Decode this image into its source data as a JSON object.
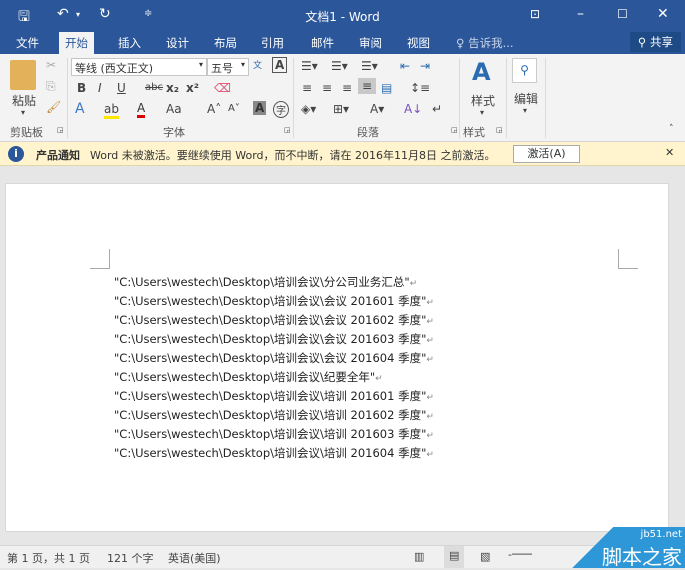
{
  "window": {
    "title": "文档1 - Word"
  },
  "tabs": [
    {
      "label": "文件"
    },
    {
      "label": "开始"
    },
    {
      "label": "插入"
    },
    {
      "label": "设计"
    },
    {
      "label": "布局"
    },
    {
      "label": "引用"
    },
    {
      "label": "邮件"
    },
    {
      "label": "审阅"
    },
    {
      "label": "视图"
    }
  ],
  "tell_me": "告诉我...",
  "share": "共享",
  "ribbon": {
    "paste": "粘贴",
    "clipboard": "剪贴板",
    "font_name": "等线 (西文正文)",
    "font_size": "五号",
    "font_group": "字体",
    "bold": "B",
    "italic": "I",
    "underline": "U",
    "strike": "abc",
    "sub": "x₂",
    "sup": "x²",
    "case": "Aa",
    "paragraph_group": "段落",
    "styles": "样式",
    "styles_group": "样式",
    "editing": "编辑"
  },
  "message": {
    "label": "产品通知",
    "text": "Word 未被激活。要继续使用 Word，而不中断，请在 2016年11月8日 之前激活。",
    "button": "激活(A)"
  },
  "document": {
    "lines": [
      "\"C:\\Users\\westech\\Desktop\\培训会议\\分公司业务汇总\"",
      "\"C:\\Users\\westech\\Desktop\\培训会议\\会议 201601 季度\"",
      "\"C:\\Users\\westech\\Desktop\\培训会议\\会议 201602 季度\"",
      "\"C:\\Users\\westech\\Desktop\\培训会议\\会议 201603 季度\"",
      "\"C:\\Users\\westech\\Desktop\\培训会议\\会议 201604 季度\"",
      "\"C:\\Users\\westech\\Desktop\\培训会议\\纪要全年\"",
      "\"C:\\Users\\westech\\Desktop\\培训会议\\培训 201601 季度\"",
      "\"C:\\Users\\westech\\Desktop\\培训会议\\培训 201602 季度\"",
      "\"C:\\Users\\westech\\Desktop\\培训会议\\培训 201603 季度\"",
      "\"C:\\Users\\westech\\Desktop\\培训会议\\培训 201604 季度\""
    ],
    "para_mark": "↵"
  },
  "status": {
    "page": "第 1 页，共 1 页",
    "words": "121 个字",
    "lang": "英语(美国)"
  },
  "watermark": {
    "site": "jb51.net",
    "name": "脚本之家"
  }
}
